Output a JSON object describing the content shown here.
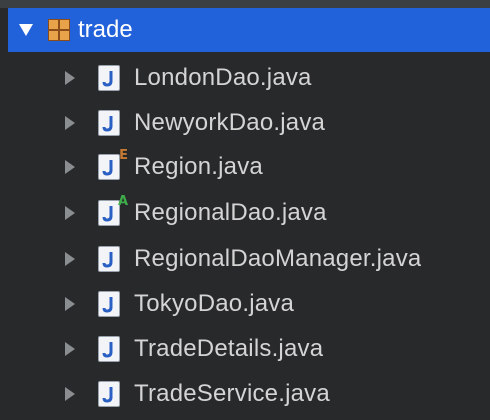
{
  "tree": {
    "package": {
      "label": "trade",
      "icon": "package-icon",
      "expanded": true
    },
    "files": [
      {
        "label": "LondonDao.java",
        "icon": "java-class-icon",
        "badge": ""
      },
      {
        "label": "NewyorkDao.java",
        "icon": "java-class-icon",
        "badge": ""
      },
      {
        "label": "Region.java",
        "icon": "java-enum-icon",
        "badge": "E"
      },
      {
        "label": "RegionalDao.java",
        "icon": "java-abstract-class-icon",
        "badge": "A"
      },
      {
        "label": "RegionalDaoManager.java",
        "icon": "java-class-icon",
        "badge": ""
      },
      {
        "label": "TokyoDao.java",
        "icon": "java-class-icon",
        "badge": ""
      },
      {
        "label": "TradeDetails.java",
        "icon": "java-class-icon",
        "badge": ""
      },
      {
        "label": "TradeService.java",
        "icon": "java-class-icon",
        "badge": ""
      }
    ]
  },
  "colors": {
    "selection": "#2162db",
    "background": "#27292b",
    "text": "#d4d4d4",
    "enum_badge": "#c77a32",
    "abstract_badge": "#3fae4a"
  }
}
